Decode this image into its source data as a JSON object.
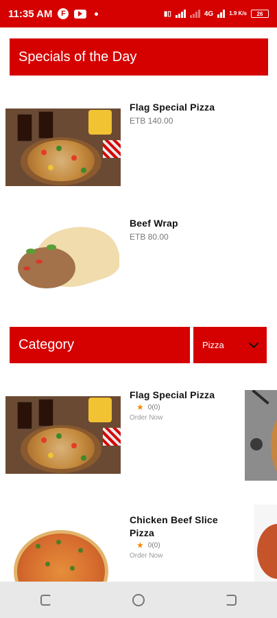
{
  "status_bar": {
    "time": "11:35 AM",
    "icons": [
      "f-circle-icon",
      "youtube-icon",
      "dot-icon",
      "vibrate-icon",
      "signal-icon",
      "signal-dim-icon",
      "4g-icon",
      "wifi-icon"
    ],
    "network_1": "4G",
    "speed": "1.9 K/s",
    "battery": "26"
  },
  "specials": {
    "title": "Specials of the Day",
    "items": [
      {
        "name": "Flag Special Pizza",
        "price": "ETB 140.00"
      },
      {
        "name": "Beef Wrap",
        "price": "ETB 80.00"
      }
    ]
  },
  "category": {
    "title": "Category",
    "selected": "Pizza",
    "items": [
      {
        "name": "Flag Special Pizza",
        "rating": "0(0)",
        "order_label": "Order Now"
      },
      {
        "name": "Chicken Beef Slice Pizza",
        "rating": "0(0)",
        "order_label": "Order Now"
      }
    ]
  },
  "colors": {
    "brand_red": "#d50000",
    "star_orange": "#f08a00",
    "nav_bg": "#e8e8e8"
  }
}
